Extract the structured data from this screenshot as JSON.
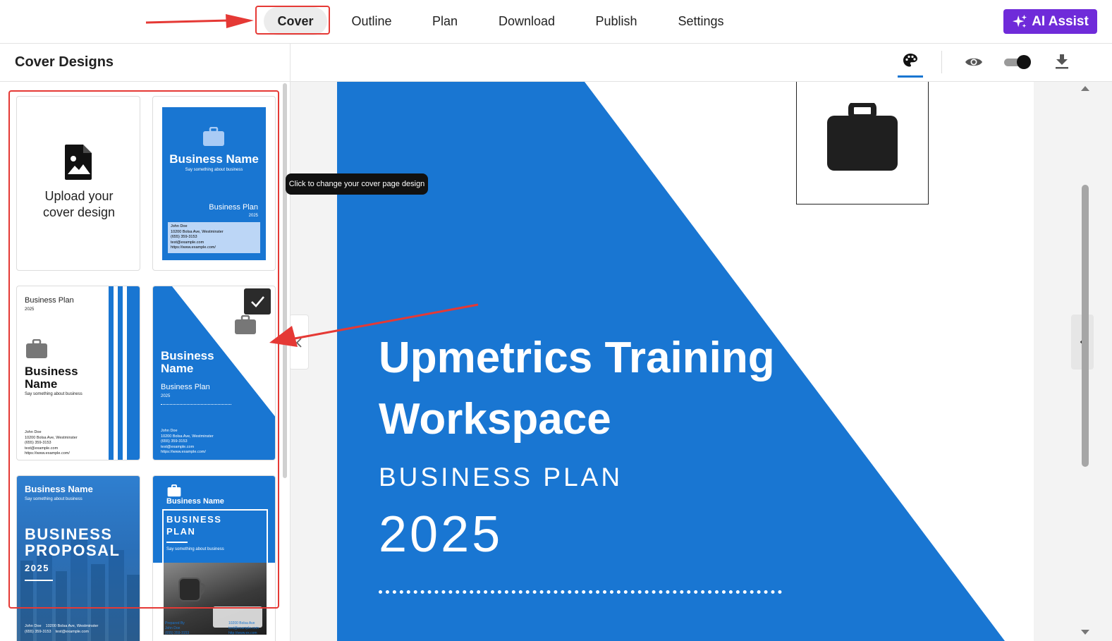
{
  "nav": {
    "tabs": [
      {
        "label": "Cover",
        "active": true
      },
      {
        "label": "Outline"
      },
      {
        "label": "Plan"
      },
      {
        "label": "Download"
      },
      {
        "label": "Publish"
      },
      {
        "label": "Settings"
      }
    ],
    "ai_assist_label": "AI Assist"
  },
  "sidebar": {
    "title": "Cover Designs",
    "upload_label_line1": "Upload your",
    "upload_label_line2": "cover design"
  },
  "designs": {
    "d1": {
      "business_name": "Business Name",
      "tagline": "Say something about business",
      "plan": "Business Plan",
      "year": "2025",
      "contact": [
        "John Doe",
        "10200 Bolsa Ave, Westminster",
        "(655) 359-3153",
        "test@example.com",
        "https://www.example.com/"
      ]
    },
    "d2": {
      "plan": "Business Plan",
      "year": "2025",
      "name1": "Business",
      "name2": "Name",
      "tagline": "Say something about business",
      "contact": [
        "John Doe",
        "10200 Bolsa Ave, Westminster",
        "(655) 359-3153",
        "test@example.com",
        "https://www.example.com/"
      ]
    },
    "d3": {
      "name1": "Business",
      "name2": "Name",
      "plan": "Business Plan",
      "year": "2025",
      "contact": [
        "John Doe",
        "10200 Bolsa Ave, Westminster",
        "(655) 359-3153",
        "test@example.com",
        "https://www.example.com/"
      ]
    },
    "d4": {
      "business_name": "Business Name",
      "tagline": "Say something about business",
      "line1": "BUSINESS",
      "line2": "PROPOSAL",
      "year": "2025",
      "footer_name": "John Doe",
      "footer_address": "10200 Bolsa Ave, Westminster",
      "footer_phone": "(655) 359-3153",
      "footer_email": "test@example.com"
    },
    "d5": {
      "business_name": "Business Name",
      "line1": "BUSINESS",
      "line2": "PLAN",
      "tagline": "Say something about business",
      "prepared_by": "Prepared By",
      "name": "John Doe",
      "phone": "(655) 359-3153",
      "address": "10200 Bolsa Ave",
      "email": "test@example.com",
      "url": "http://www.ex.com"
    }
  },
  "tooltip": "Click to change your cover page design",
  "cover": {
    "title_line1": "Upmetrics Training",
    "title_line2": "Workspace",
    "subtitle": "BUSINESS PLAN",
    "year": "2025"
  },
  "colors": {
    "brand_blue": "#1976d2",
    "ai_purple": "#6f2bd9",
    "annotation_red": "#e53935"
  }
}
